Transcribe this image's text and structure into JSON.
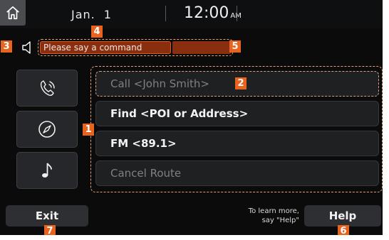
{
  "status": {
    "month": "Jan.",
    "day": "1",
    "time": "12:00",
    "ampm": "AM"
  },
  "prompt": {
    "text": "Please say a command"
  },
  "commands": [
    {
      "label": "Call <John Smith>",
      "state": "dimmed"
    },
    {
      "label": "Find <POI or Address>",
      "state": "active"
    },
    {
      "label": "FM <89.1>",
      "state": "active"
    },
    {
      "label": "Cancel Route",
      "state": "dimmed"
    }
  ],
  "side_icons": [
    "phone-voice-icon",
    "compass-icon",
    "music-note-icon"
  ],
  "bottom": {
    "exit_label": "Exit",
    "hint_line1": "To learn more,",
    "hint_line2": "say \"Help\"",
    "help_label": "Help"
  },
  "callouts": {
    "c1": "1",
    "c2": "2",
    "c3": "3",
    "c4": "4",
    "c5": "5",
    "c6": "6",
    "c7": "7"
  },
  "colors": {
    "callout": "#e8641e",
    "prompt_fill": "#8a2e10",
    "dashed_outline": "#e8a072"
  }
}
